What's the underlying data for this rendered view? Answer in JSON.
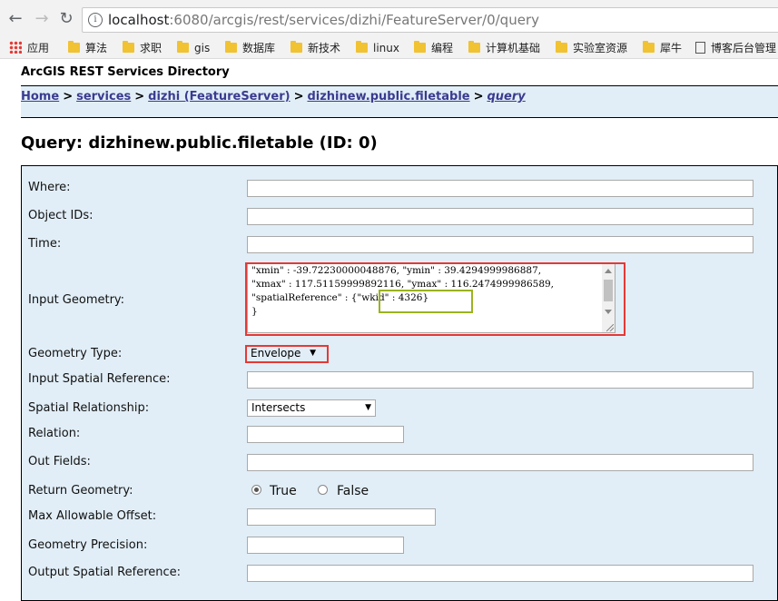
{
  "browser": {
    "url_host": "localhost",
    "url_rest": ":6080/arcgis/rest/services/dizhi/FeatureServer/0/query",
    "bookmarks": [
      "应用",
      "算法",
      "求职",
      "gis",
      "数据库",
      "新技术",
      "linux",
      "编程",
      "计算机基础",
      "实验室资源",
      "犀牛",
      "博客后台管理"
    ]
  },
  "page": {
    "directory_title": "ArcGIS REST Services Directory",
    "breadcrumb": {
      "home": "Home",
      "services": "services",
      "service": "dizhi (FeatureServer)",
      "layer": "dizhinew.public.filetable",
      "current": "query",
      "separator": ">"
    },
    "title": "Query: dizhinew.public.filetable (ID: 0)"
  },
  "form": {
    "where_label": "Where:",
    "object_ids_label": "Object IDs:",
    "time_label": "Time:",
    "input_geometry_label": "Input Geometry:",
    "input_geometry_lines": [
      " \"xmin\" : -39.72230000048876, \"ymin\" : 39.4294999986887,",
      "\"xmax\" : 117.51159999892116, \"ymax\" : 116.2474999986589,",
      "\"spatialReference\" : {\"wkid\" : 4326}",
      "}"
    ],
    "geometry_type_label": "Geometry Type:",
    "geometry_type_value": "Envelope",
    "input_sr_label": "Input Spatial Reference:",
    "spatial_rel_label": "Spatial Relationship:",
    "spatial_rel_value": "Intersects",
    "relation_label": "Relation:",
    "out_fields_label": "Out Fields:",
    "return_geometry_label": "Return Geometry:",
    "true_label": "True",
    "false_label": "False",
    "max_offset_label": "Max Allowable Offset:",
    "geometry_precision_label": "Geometry Precision:",
    "output_sr_label": "Output Spatial Reference:"
  },
  "colors": {
    "highlight_red": "#e53935",
    "highlight_green": "#9ab31f",
    "panel_bg": "#e1eef7",
    "link": "#3b3b8f"
  }
}
